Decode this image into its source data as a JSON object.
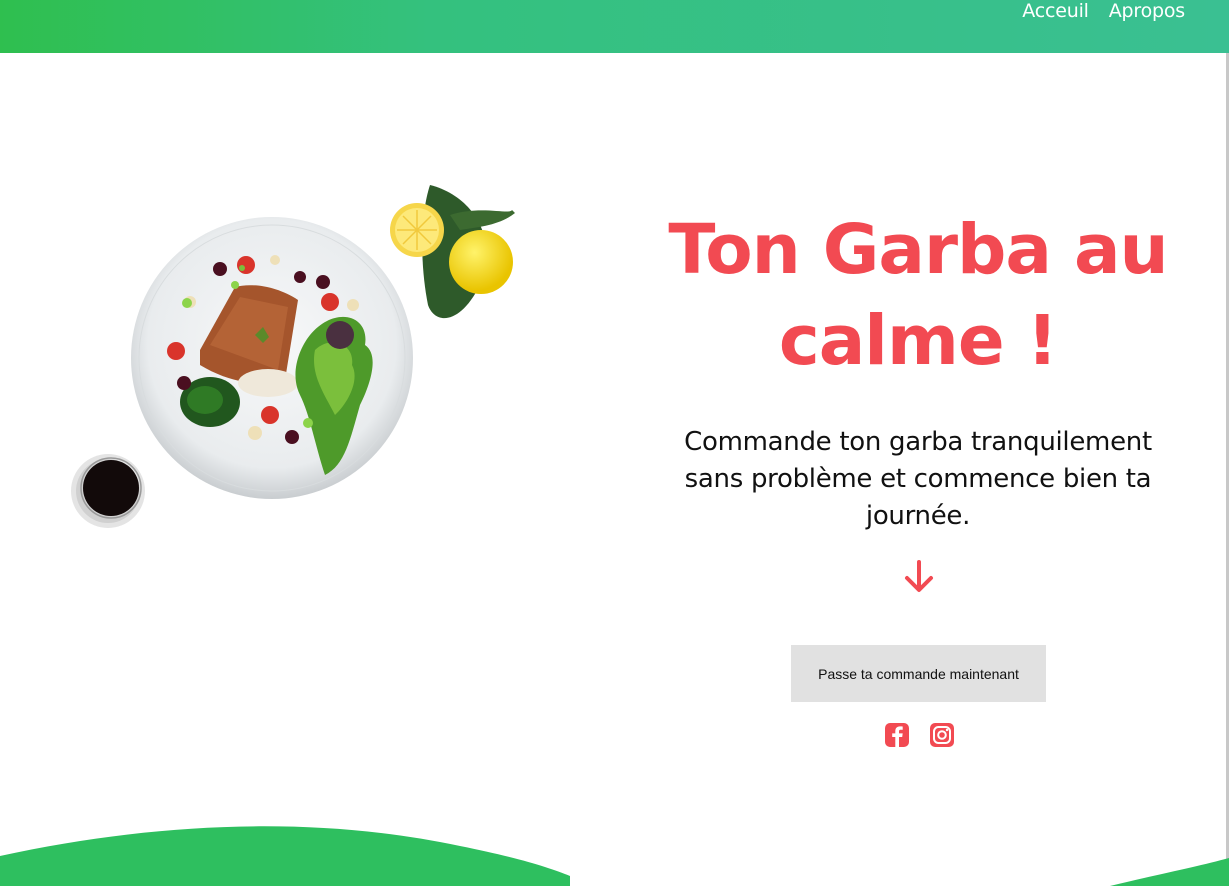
{
  "nav": {
    "items": [
      {
        "label": "Acceuil"
      },
      {
        "label": "Apropos"
      }
    ]
  },
  "hero": {
    "title": "Ton Garba au calme !",
    "subtitle": "Commande ton garba tranquilement sans problème et commence bien ta journée.",
    "cta_label": "Passe ta commande maintenant"
  },
  "social": {
    "facebook_icon": "facebook-icon",
    "instagram_icon": "instagram-icon"
  },
  "colors": {
    "accent": "#f24a52",
    "green_start": "#2fbf4f",
    "green_end": "#3ac092",
    "wave": "#2ebf5f",
    "button_bg": "#e1e1e1"
  }
}
